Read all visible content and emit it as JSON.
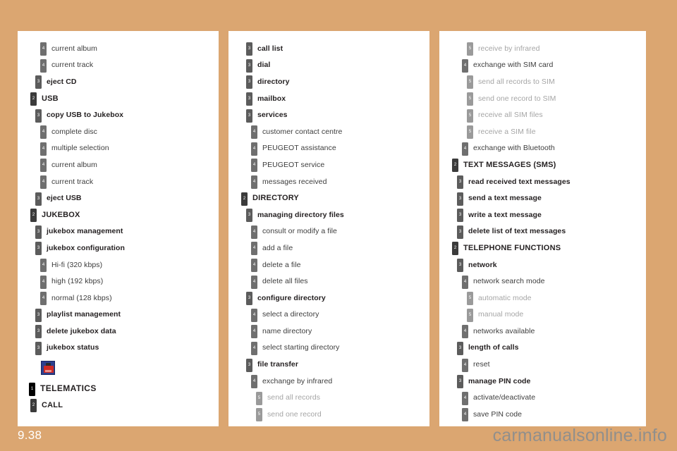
{
  "page": {
    "number": "9.38",
    "watermark": "carmanualsonline.info",
    "background_color": "#dba671",
    "card_color": "#ffffff"
  },
  "level_colors": {
    "1": "#000000",
    "2": "#3b3b3b",
    "3": "#5c5c5c",
    "4": "#6f6f6f",
    "5": "#9a9a9a"
  },
  "columns": [
    {
      "id": "column-1",
      "rows": [
        {
          "level": 4,
          "label": "current album"
        },
        {
          "level": 4,
          "label": "current track"
        },
        {
          "level": 3,
          "label": "eject CD"
        },
        {
          "level": 2,
          "label": "USB"
        },
        {
          "level": 3,
          "label": "copy USB to Jukebox"
        },
        {
          "level": 4,
          "label": "complete disc"
        },
        {
          "level": 4,
          "label": "multiple selection"
        },
        {
          "level": 4,
          "label": "current album"
        },
        {
          "level": 4,
          "label": "current track"
        },
        {
          "level": 3,
          "label": "eject USB"
        },
        {
          "level": 2,
          "label": "JUKEBOX"
        },
        {
          "level": 3,
          "label": "jukebox management"
        },
        {
          "level": 3,
          "label": "jukebox configuration"
        },
        {
          "level": 4,
          "label": "Hi-fi (320 kbps)"
        },
        {
          "level": 4,
          "label": "high (192 kbps)"
        },
        {
          "level": 4,
          "label": "normal (128 kbps)"
        },
        {
          "level": 3,
          "label": "playlist management"
        },
        {
          "level": 3,
          "label": "delete jukebox data"
        },
        {
          "level": 3,
          "label": "jukebox status"
        },
        {
          "type": "icon",
          "icon": "telematics-phone-icon"
        },
        {
          "level": 1,
          "label": "TELEMATICS"
        },
        {
          "level": 2,
          "label": "CALL"
        }
      ]
    },
    {
      "id": "column-2",
      "rows": [
        {
          "level": 3,
          "label": "call list"
        },
        {
          "level": 3,
          "label": "dial"
        },
        {
          "level": 3,
          "label": "directory"
        },
        {
          "level": 3,
          "label": "mailbox"
        },
        {
          "level": 3,
          "label": "services"
        },
        {
          "level": 4,
          "label": "customer contact centre"
        },
        {
          "level": 4,
          "label": "PEUGEOT assistance"
        },
        {
          "level": 4,
          "label": "PEUGEOT service"
        },
        {
          "level": 4,
          "label": "messages received"
        },
        {
          "level": 2,
          "label": "DIRECTORY"
        },
        {
          "level": 3,
          "label": "managing directory files"
        },
        {
          "level": 4,
          "label": "consult or modify a file"
        },
        {
          "level": 4,
          "label": "add a file"
        },
        {
          "level": 4,
          "label": "delete a file"
        },
        {
          "level": 4,
          "label": "delete all files"
        },
        {
          "level": 3,
          "label": "configure directory"
        },
        {
          "level": 4,
          "label": "select a directory"
        },
        {
          "level": 4,
          "label": "name directory"
        },
        {
          "level": 4,
          "label": "select starting directory"
        },
        {
          "level": 3,
          "label": "file transfer"
        },
        {
          "level": 4,
          "label": "exchange by infrared"
        },
        {
          "level": 5,
          "label": "send all records"
        },
        {
          "level": 5,
          "label": "send one record"
        }
      ]
    },
    {
      "id": "column-3",
      "rows": [
        {
          "level": 5,
          "label": "receive by infrared"
        },
        {
          "level": 4,
          "label": "exchange with SIM card"
        },
        {
          "level": 5,
          "label": "send all records to SIM"
        },
        {
          "level": 5,
          "label": "send one record to SIM"
        },
        {
          "level": 5,
          "label": "receive all SIM files"
        },
        {
          "level": 5,
          "label": "receive a SIM file"
        },
        {
          "level": 4,
          "label": "exchange with Bluetooth"
        },
        {
          "level": 2,
          "label": "TEXT MESSAGES (SMS)"
        },
        {
          "level": 3,
          "label": "read received text messages"
        },
        {
          "level": 3,
          "label": "send a text message"
        },
        {
          "level": 3,
          "label": "write a text message"
        },
        {
          "level": 3,
          "label": "delete list of text messages"
        },
        {
          "level": 2,
          "label": "TELEPHONE FUNCTIONS"
        },
        {
          "level": 3,
          "label": "network"
        },
        {
          "level": 4,
          "label": "network search mode"
        },
        {
          "level": 5,
          "label": "automatic mode"
        },
        {
          "level": 5,
          "label": "manual mode"
        },
        {
          "level": 4,
          "label": "networks available"
        },
        {
          "level": 3,
          "label": "length of calls"
        },
        {
          "level": 4,
          "label": "reset"
        },
        {
          "level": 3,
          "label": "manage PIN code"
        },
        {
          "level": 4,
          "label": "activate/deactivate"
        },
        {
          "level": 4,
          "label": "save PIN code"
        }
      ]
    }
  ]
}
